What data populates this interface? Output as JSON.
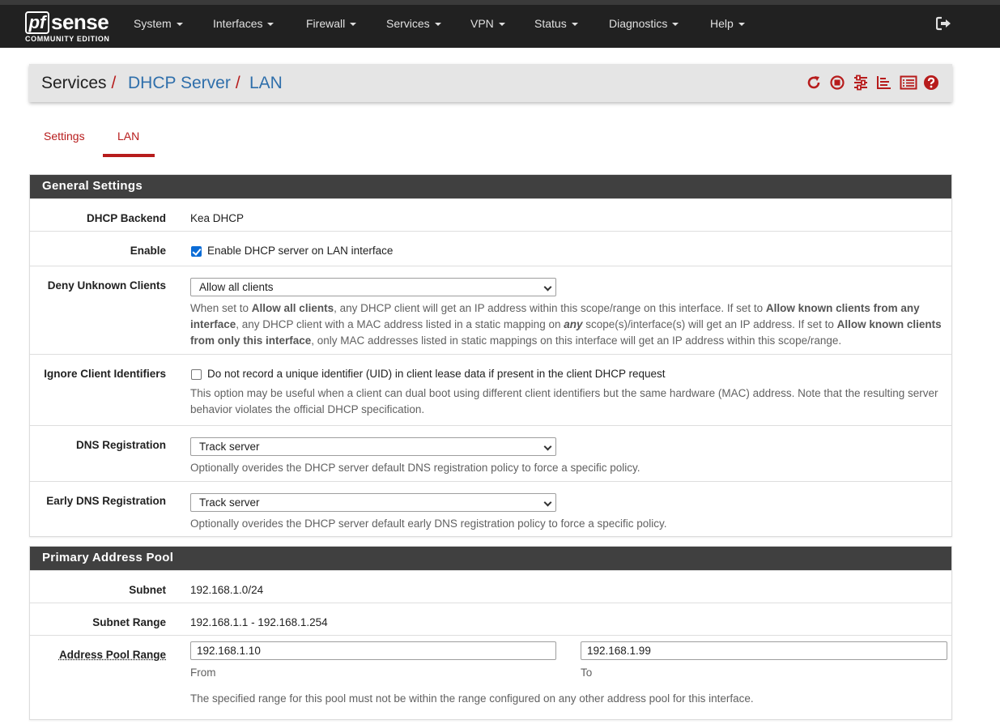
{
  "app": {
    "logo_mark": "pf",
    "logo_word": "sense",
    "edition": "COMMUNITY EDITION"
  },
  "nav": {
    "items": [
      {
        "label": "System"
      },
      {
        "label": "Interfaces"
      },
      {
        "label": "Firewall"
      },
      {
        "label": "Services"
      },
      {
        "label": "VPN"
      },
      {
        "label": "Status"
      },
      {
        "label": "Diagnostics"
      },
      {
        "label": "Help"
      }
    ],
    "logout_icon": "sign-out-icon"
  },
  "breadcrumb": {
    "root": "Services",
    "section": "DHCP Server",
    "page": "LAN",
    "separator": "/",
    "icons": [
      "restart-icon",
      "stop-icon",
      "sliders-icon",
      "log-icon",
      "list-icon",
      "help-icon"
    ]
  },
  "tabs": [
    {
      "label": "Settings"
    },
    {
      "label": "LAN",
      "active": true
    }
  ],
  "colors": {
    "accent": "#b71c1c",
    "link": "#2f6fab",
    "header_bg": "#212121",
    "panel_head": "#404040"
  },
  "general": {
    "title": "General Settings",
    "backend": {
      "label": "DHCP Backend",
      "value": "Kea DHCP"
    },
    "enable": {
      "label": "Enable",
      "checkbox_label": "Enable DHCP server on LAN interface",
      "checked": true
    },
    "deny": {
      "label": "Deny Unknown Clients",
      "selected": "Allow all clients",
      "help": {
        "t1": "When set to ",
        "b1": "Allow all clients",
        "t2": ", any DHCP client will get an IP address within this scope/range on this interface. If set to ",
        "b2": "Allow known clients from any interface",
        "t3": ", any DHCP client with a MAC address listed in a static mapping on ",
        "b3": "any",
        "t4": " scope(s)/interface(s) will get an IP address. If set to ",
        "b4": "Allow known clients from only this interface",
        "t5": ", only MAC addresses listed in static mappings on this interface will get an IP address within this scope/range."
      }
    },
    "ignore": {
      "label": "Ignore Client Identifiers",
      "checkbox_label": "Do not record a unique identifier (UID) in client lease data if present in the client DHCP request",
      "checked": false,
      "help": "This option may be useful when a client can dual boot using different client identifiers but the same hardware (MAC) address. Note that the resulting server behavior violates the official DHCP specification."
    },
    "dns_reg": {
      "label": "DNS Registration",
      "selected": "Track server",
      "help": "Optionally overides the DHCP server default DNS registration policy to force a specific policy."
    },
    "early_dns": {
      "label": "Early DNS Registration",
      "selected": "Track server",
      "help": "Optionally overides the DHCP server default early DNS registration policy to force a specific policy."
    }
  },
  "pool": {
    "title": "Primary Address Pool",
    "subnet": {
      "label": "Subnet",
      "value": "192.168.1.0/24"
    },
    "range": {
      "label": "Subnet Range",
      "value": "192.168.1.1 - 192.168.1.254"
    },
    "pool_range": {
      "label": "Address Pool Range",
      "from_value": "192.168.1.10",
      "from_label": "From",
      "to_value": "192.168.1.99",
      "to_label": "To",
      "help": "The specified range for this pool must not be within the range configured on any other address pool for this interface."
    }
  }
}
